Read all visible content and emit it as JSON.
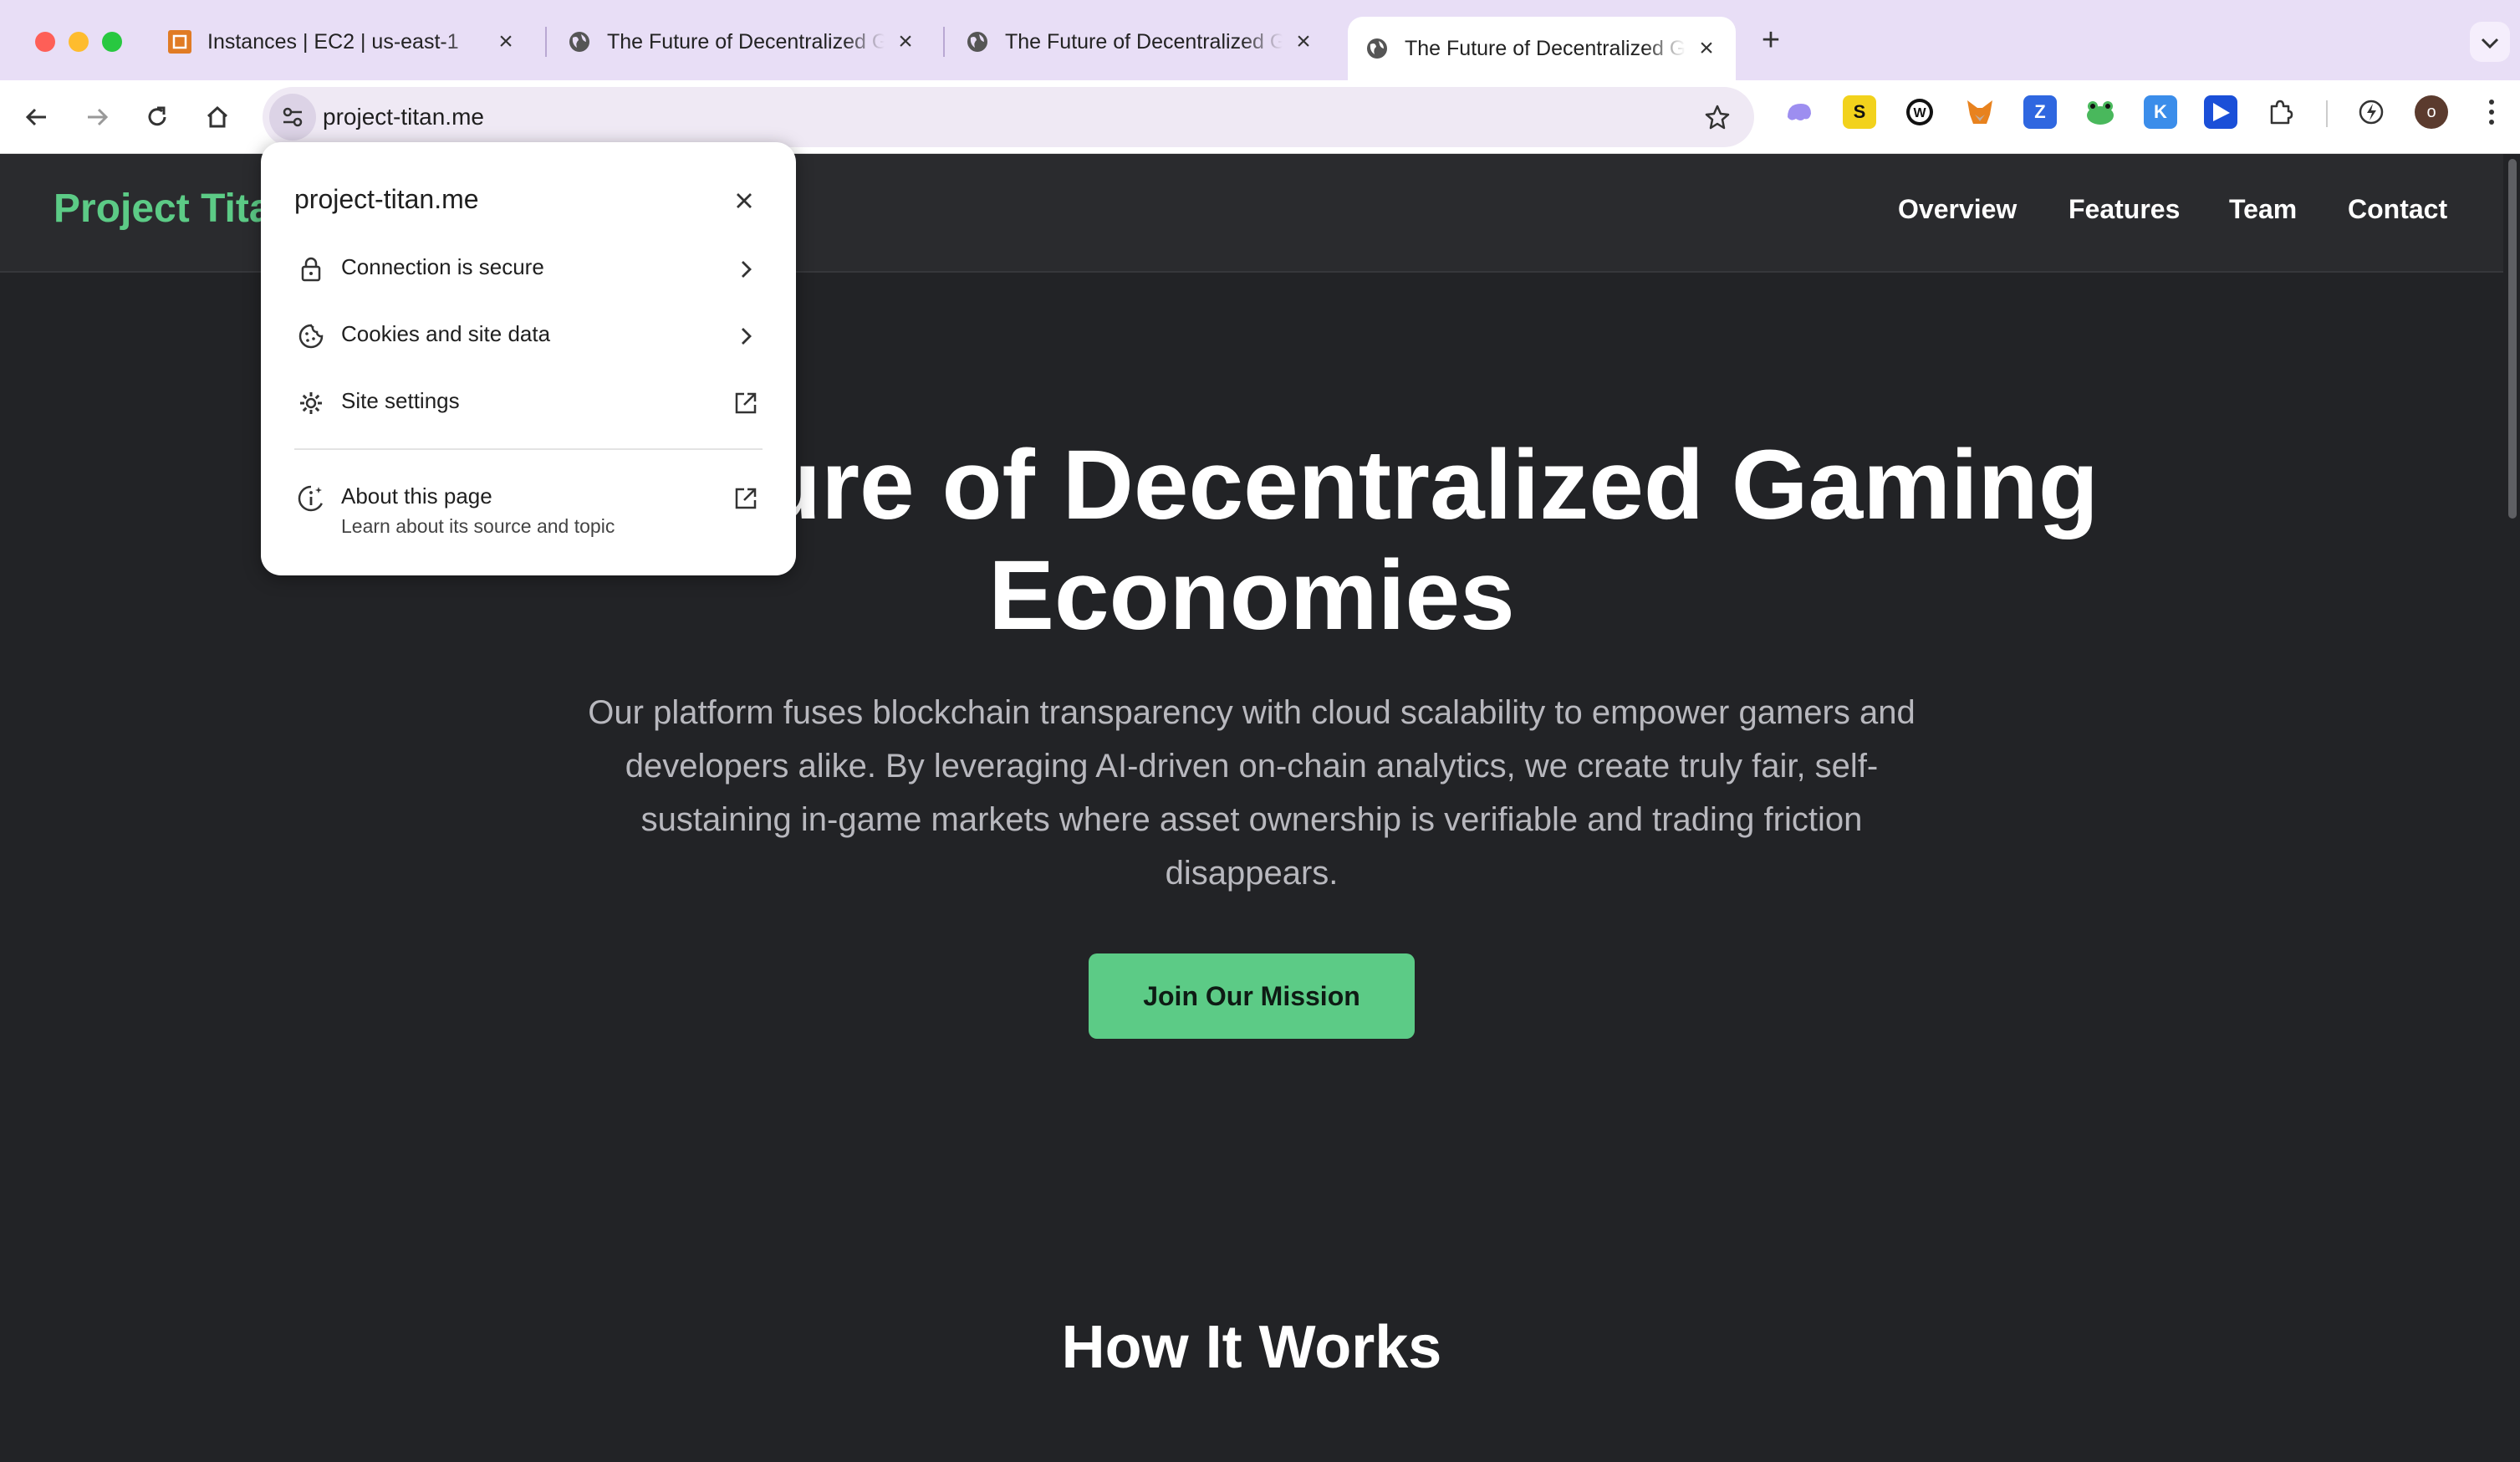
{
  "browser": {
    "tabs": [
      {
        "title": "Instances | EC2 | us-east-1",
        "icon": "aws-ec2-icon",
        "active": false
      },
      {
        "title": "The Future of Decentralized Gaming Economies",
        "icon": "globe-icon",
        "active": false
      },
      {
        "title": "The Future of Decentralized Gaming Economies",
        "icon": "globe-icon",
        "active": false
      },
      {
        "title": "The Future of Decentralized Gaming Economies",
        "icon": "globe-icon",
        "active": true
      }
    ],
    "new_tab_label": "+",
    "address_bar": {
      "url": "project-titan.me"
    },
    "profile_initial": "o",
    "extensions": [
      "ghost-extension",
      "s-extension",
      "wordpress-extension",
      "metamask-extension",
      "z-extension",
      "frog-extension",
      "k-extension",
      "flag-extension"
    ]
  },
  "site_info_popup": {
    "domain": "project-titan.me",
    "items": [
      {
        "label": "Connection is secure",
        "icon": "lock-icon",
        "action": "chevron-right-icon"
      },
      {
        "label": "Cookies and site data",
        "icon": "cookie-icon",
        "action": "chevron-right-icon"
      },
      {
        "label": "Site settings",
        "icon": "gear-icon",
        "action": "external-link-icon"
      },
      {
        "label": "About this page",
        "sublabel": "Learn about its source and topic",
        "icon": "info-icon",
        "action": "external-link-icon"
      }
    ]
  },
  "site": {
    "logo": "Project Titan",
    "nav": [
      "Overview",
      "Features",
      "Team",
      "Contact"
    ],
    "hero": {
      "title_line1": "The Future of Decentralized Gaming",
      "title_line2": "Economies",
      "description": "Our platform fuses blockchain transparency with cloud scalability to empower gamers and developers alike. By leveraging AI-driven on-chain analytics, we create truly fair, self-sustaining in-game markets where asset ownership is verifiable and trading friction disappears.",
      "cta": "Join Our Mission"
    },
    "section_title": "How It Works"
  },
  "colors": {
    "accent": "#5ccb86",
    "page_bg": "#222326",
    "tabstrip_bg": "#e8def6"
  }
}
